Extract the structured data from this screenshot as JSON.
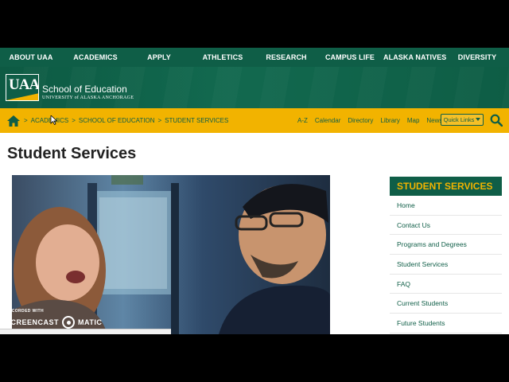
{
  "topnav": {
    "items": [
      "ABOUT UAA",
      "ACADEMICS",
      "APPLY",
      "ATHLETICS",
      "RESEARCH",
      "CAMPUS LIFE",
      "ALASKA NATIVES",
      "DIVERSITY"
    ]
  },
  "banner": {
    "logo_text": "UAA",
    "school": "School of Education",
    "university": "UNIVERSITY of ALASKA ANCHORAGE"
  },
  "breadcrumb": {
    "items": [
      "ACADEMICS",
      "SCHOOL OF EDUCATION",
      "STUDENT SERVICES"
    ],
    "separator": ">"
  },
  "utility_links": [
    "A-Z",
    "Calendar",
    "Directory",
    "Library",
    "Map",
    "News"
  ],
  "quick_links": "Quick Links",
  "page_title": "Student Services",
  "sidebar": {
    "heading": "STUDENT SERVICES",
    "items": [
      "Home",
      "Contact Us",
      "Programs and Degrees",
      "Student Services",
      "FAQ",
      "Current Students",
      "Future Students"
    ]
  },
  "watermark": {
    "small": "RECORDED WITH",
    "left": "SCREENCAST",
    "right": "MATIC"
  },
  "colors": {
    "uaa_green": "#0f5e47",
    "uaa_gold": "#f2b300"
  }
}
